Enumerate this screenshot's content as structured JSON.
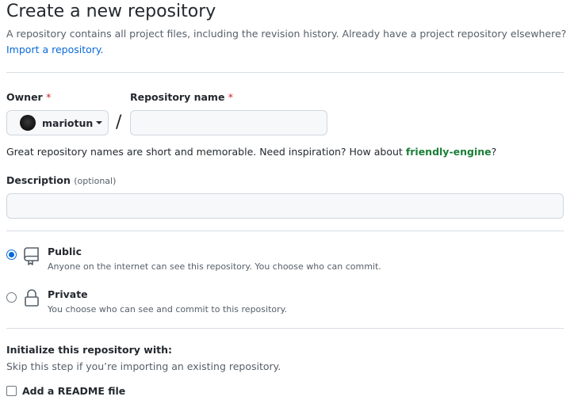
{
  "header": {
    "title": "Create a new repository",
    "description": "A repository contains all project files, including the revision history. Already have a project repository elsewhere?",
    "import_link": "Import a repository."
  },
  "owner": {
    "label": "Owner",
    "required_mark": "*",
    "selected": "mariotun",
    "icon": "avatar"
  },
  "separator": "/",
  "repo_name": {
    "label": "Repository name",
    "required_mark": "*",
    "value": "",
    "placeholder": ""
  },
  "name_hint": {
    "text": "Great repository names are short and memorable. Need inspiration? How about",
    "suggestion": "friendly-engine",
    "suffix": "?"
  },
  "description_field": {
    "label": "Description",
    "optional": "(optional)",
    "value": ""
  },
  "visibility": {
    "selected": "public",
    "options": [
      {
        "id": "public",
        "title": "Public",
        "description": "Anyone on the internet can see this repository. You choose who can commit.",
        "icon": "repo-icon"
      },
      {
        "id": "private",
        "title": "Private",
        "description": "You choose who can see and commit to this repository.",
        "icon": "lock-icon"
      }
    ]
  },
  "initialize": {
    "title": "Initialize this repository with:",
    "subtitle": "Skip this step if you’re importing an existing repository.",
    "readme_label": "Add a README file",
    "readme_checked": false
  },
  "colors": {
    "link": "#0969da",
    "suggestion": "#1a7f37",
    "required": "#cf222e"
  }
}
